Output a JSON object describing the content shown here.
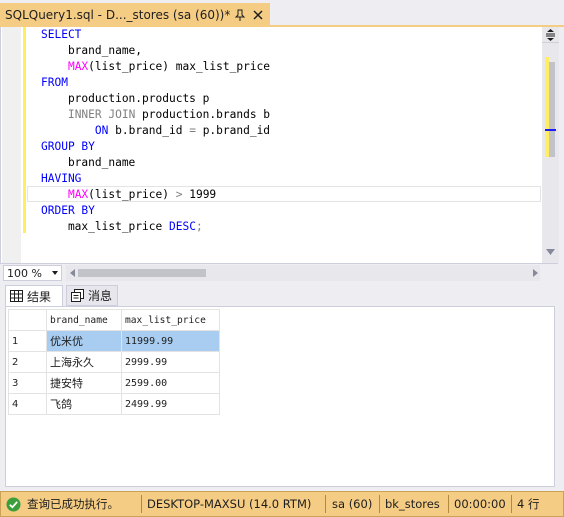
{
  "tab": {
    "title": "SQLQuery1.sql - D..._stores (sa (60))*"
  },
  "editor": {
    "lines": [
      [
        {
          "t": "SELECT",
          "c": "kw"
        }
      ],
      [
        {
          "t": "    brand_name,",
          "c": "plain"
        }
      ],
      [
        {
          "t": "    ",
          "c": "plain"
        },
        {
          "t": "MAX",
          "c": "fn"
        },
        {
          "t": "(list_price) max_list_price",
          "c": "plain"
        }
      ],
      [
        {
          "t": "FROM",
          "c": "kw"
        }
      ],
      [
        {
          "t": "    production.products p",
          "c": "plain"
        }
      ],
      [
        {
          "t": "    ",
          "c": "plain"
        },
        {
          "t": "INNER JOIN",
          "c": "gray"
        },
        {
          "t": " production.brands b",
          "c": "plain"
        }
      ],
      [
        {
          "t": "        ",
          "c": "plain"
        },
        {
          "t": "ON",
          "c": "kw"
        },
        {
          "t": " b.brand_id ",
          "c": "plain"
        },
        {
          "t": "=",
          "c": "gray"
        },
        {
          "t": " p.brand_id",
          "c": "plain"
        }
      ],
      [
        {
          "t": "GROUP BY",
          "c": "kw"
        }
      ],
      [
        {
          "t": "    brand_name",
          "c": "plain"
        }
      ],
      [
        {
          "t": "HAVING",
          "c": "kw"
        }
      ],
      [
        {
          "t": "    ",
          "c": "plain"
        },
        {
          "t": "MAX",
          "c": "fn"
        },
        {
          "t": "(list_price) ",
          "c": "plain"
        },
        {
          "t": ">",
          "c": "gray"
        },
        {
          "t": " 1999",
          "c": "plain"
        }
      ],
      [
        {
          "t": "ORDER BY",
          "c": "kw"
        }
      ],
      [
        {
          "t": "    max_list_price ",
          "c": "plain"
        },
        {
          "t": "DESC",
          "c": "kw"
        },
        {
          "t": ";",
          "c": "gray"
        }
      ]
    ]
  },
  "zoom": {
    "value": "100 %"
  },
  "results_tabs": {
    "results": "结果",
    "messages": "消息"
  },
  "grid": {
    "headers": [
      "brand_name",
      "max_list_price"
    ],
    "rows": [
      {
        "n": "1",
        "brand": "优米优",
        "price": "11999.99"
      },
      {
        "n": "2",
        "brand": "上海永久",
        "price": "2999.99"
      },
      {
        "n": "3",
        "brand": "捷安特",
        "price": "2599.00"
      },
      {
        "n": "4",
        "brand": "飞鸽",
        "price": "2499.99"
      }
    ]
  },
  "status": {
    "message": "查询已成功执行。",
    "server": "DESKTOP-MAXSU (14.0 RTM)",
    "user": "sa (60)",
    "database": "bk_stores",
    "elapsed": "00:00:00",
    "rows": "4 行"
  },
  "colors": {
    "accent": "#f5cc84",
    "keyword": "#0000ff",
    "function": "#ff00ff",
    "operator": "#808080",
    "selection": "#a8cdf1",
    "success": "#3a9e3a"
  }
}
